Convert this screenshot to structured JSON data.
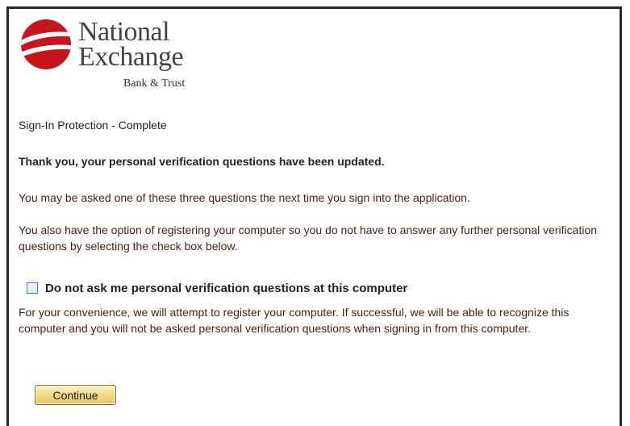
{
  "logo": {
    "name_line1": "National",
    "name_line2": "Exchange",
    "name_line3": "Bank & Trust",
    "mark_color": "#c4161c"
  },
  "page": {
    "title": "Sign-In Protection - Complete",
    "confirmation": "Thank you, your personal verification questions have been updated.",
    "info_next_signin": "You may be asked one of these three questions the next time you sign into the application.",
    "info_register_option": "You also have the option of registering your computer so you do not have to answer any further personal verification questions by selecting the check box below.",
    "register_checkbox_label": "Do not ask me personal verification questions at this computer",
    "register_explanation": "For your convenience, we will attempt to register your computer. If successful, we will be able to recognize this computer and you will not be asked personal verification questions when signing in from this computer.",
    "register_checkbox_checked": false
  },
  "actions": {
    "continue_label": "Continue"
  },
  "colors": {
    "body_text": "#4a2418",
    "heading_text": "#222222",
    "button_fill": "#f0d584"
  }
}
